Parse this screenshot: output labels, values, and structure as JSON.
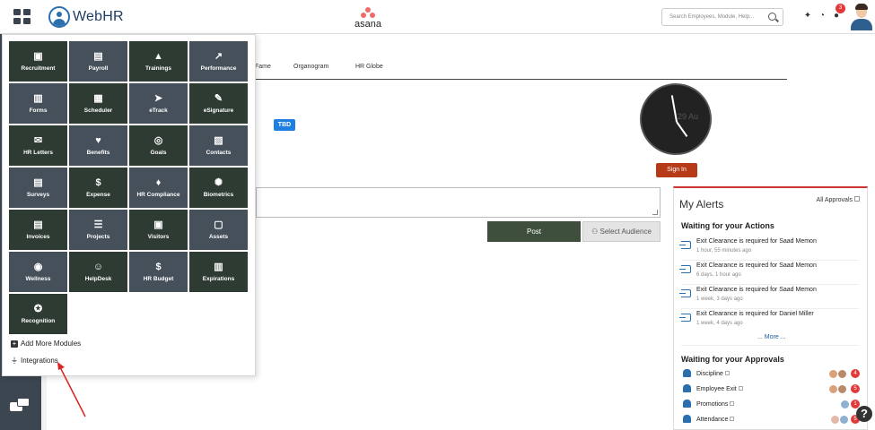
{
  "header": {
    "logo_text": "WebHR",
    "brand_text": "asana",
    "search_placeholder": "Search Employees, Module, Help...",
    "notification_count": "3"
  },
  "tabs": [
    "Fame",
    "Organogram",
    "HR Globe"
  ],
  "tbd_badge": "TBD",
  "clock": {
    "date_text": "29 Au"
  },
  "signin_label": "Sign In",
  "post_label": "Post",
  "audience_label": "Select Audience",
  "alerts": {
    "title": "My Alerts",
    "all_approvals": "All Approvals",
    "actions_title": "Waiting for your Actions",
    "items": [
      {
        "text": "Exit Clearance is required for Saad Memon",
        "time": "1 hour, 55 minutes ago"
      },
      {
        "text": "Exit Clearance is required for Saad Memon",
        "time": "6 days, 1 hour ago"
      },
      {
        "text": "Exit Clearance is required for Saad Memon",
        "time": "1 week, 3 days ago"
      },
      {
        "text": "Exit Clearance is required for Daniel Miller",
        "time": "1 week, 4 days ago"
      }
    ],
    "more": "... More ...",
    "approvals_title": "Waiting for your Approvals",
    "approvals": [
      {
        "label": "Discipline",
        "count": "4"
      },
      {
        "label": "Employee Exit",
        "count": "5"
      },
      {
        "label": "Promotions",
        "count": "1"
      },
      {
        "label": "Attendance",
        "count": "5"
      }
    ]
  },
  "modules": [
    {
      "label": "Recruitment",
      "icon": "recruitment-icon"
    },
    {
      "label": "Payroll",
      "icon": "payroll-icon"
    },
    {
      "label": "Trainings",
      "icon": "trainings-icon"
    },
    {
      "label": "Performance",
      "icon": "performance-icon"
    },
    {
      "label": "Forms",
      "icon": "forms-icon"
    },
    {
      "label": "Scheduler",
      "icon": "scheduler-icon"
    },
    {
      "label": "eTrack",
      "icon": "etrack-icon"
    },
    {
      "label": "eSignature",
      "icon": "esignature-icon"
    },
    {
      "label": "HR Letters",
      "icon": "hr-letters-icon"
    },
    {
      "label": "Benefits",
      "icon": "benefits-icon"
    },
    {
      "label": "Goals",
      "icon": "goals-icon"
    },
    {
      "label": "Contacts",
      "icon": "contacts-icon"
    },
    {
      "label": "Surveys",
      "icon": "surveys-icon"
    },
    {
      "label": "Expense",
      "icon": "expense-icon"
    },
    {
      "label": "HR Compliance",
      "icon": "hr-compliance-icon"
    },
    {
      "label": "Biometrics",
      "icon": "biometrics-icon"
    },
    {
      "label": "Invoices",
      "icon": "invoices-icon"
    },
    {
      "label": "Projects",
      "icon": "projects-icon"
    },
    {
      "label": "Visitors",
      "icon": "visitors-icon"
    },
    {
      "label": "Assets",
      "icon": "assets-icon"
    },
    {
      "label": "Wellness",
      "icon": "wellness-icon"
    },
    {
      "label": "HelpDesk",
      "icon": "helpdesk-icon"
    },
    {
      "label": "HR Budget",
      "icon": "hr-budget-icon"
    },
    {
      "label": "Expirations",
      "icon": "expirations-icon"
    },
    {
      "label": "Recognition",
      "icon": "recognition-icon"
    }
  ],
  "menu_links": {
    "add_modules": "Add More Modules",
    "integrations": "Integrations"
  },
  "colors": {
    "tile_dark": "#2e3b33",
    "tile_gray": "#46505b",
    "sidenav": "#3b4651",
    "signin": "#b63a17",
    "post": "#3f4f3e",
    "badge": "#e03a3a",
    "accent": "#2b6fae"
  }
}
